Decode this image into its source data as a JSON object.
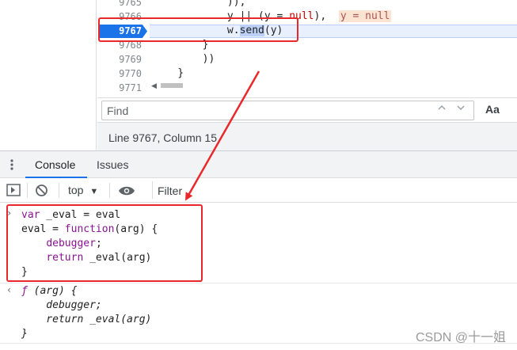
{
  "editor": {
    "lines": [
      {
        "num": "9765",
        "code": "            )),"
      },
      {
        "num": "9766",
        "code_before": "            y || (y = ",
        "code_null": "null",
        "code_after": "),",
        "inline_value": "y = null"
      },
      {
        "num": "9767",
        "code_indent": "            ",
        "code_obj": "w.",
        "code_fn": "send",
        "code_tail": "(y)"
      },
      {
        "num": "9768",
        "code": "        }"
      },
      {
        "num": "9769",
        "code": "        ))"
      },
      {
        "num": "9770",
        "code": "    }"
      },
      {
        "num": "9771",
        "code": ""
      }
    ]
  },
  "find": {
    "placeholder": "Find",
    "prev_icon": "chevron-up",
    "next_icon": "chevron-down",
    "match_case_label": "Aa"
  },
  "status": {
    "position": "Line 9767, Column 15"
  },
  "drawer": {
    "tabs": [
      {
        "label": "Console",
        "active": true
      },
      {
        "label": "Issues",
        "active": false
      }
    ]
  },
  "console_toolbar": {
    "context": "top",
    "filter_placeholder": "Filter"
  },
  "console": {
    "input": [
      {
        "kw": "var",
        "rest": " _eval = eval"
      },
      {
        "pre": "eval = ",
        "kw": "function",
        "rest": "(arg) {"
      },
      {
        "pre": "    ",
        "kw": "debugger",
        "rest": ";"
      },
      {
        "pre": "    ",
        "kw": "return",
        "rest": " _eval(arg)"
      },
      {
        "pre": "",
        "kw": "",
        "rest": "}"
      }
    ],
    "output": [
      {
        "fn": "ƒ",
        "rest": " (arg) {"
      },
      {
        "rest": "    debugger;"
      },
      {
        "rest": "    return _eval(arg)"
      },
      {
        "rest": "}"
      }
    ]
  },
  "watermark": "CSDN @十一姐",
  "colors": {
    "accent": "#1a73e8",
    "annotation_red": "#e8282b",
    "keyword": "#881391"
  }
}
